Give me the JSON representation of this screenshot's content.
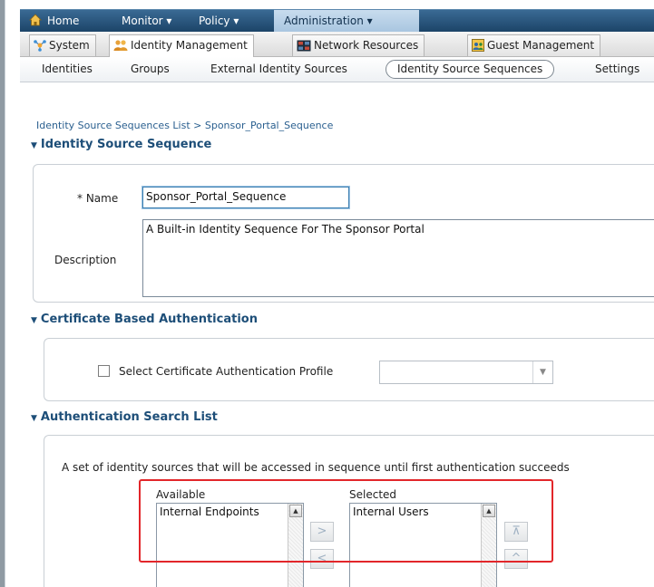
{
  "topnav": {
    "home": "Home",
    "monitor": "Monitor ▾",
    "policy": "Policy ▾",
    "administration": "Administration ▾"
  },
  "subtabs": {
    "system": "System",
    "identity_management": "Identity Management",
    "network_resources": "Network Resources",
    "guest_management": "Guest Management"
  },
  "thirdnav": {
    "identities": "Identities",
    "groups": "Groups",
    "external": "External Identity Sources",
    "sequences": "Identity Source Sequences",
    "settings": "Settings"
  },
  "breadcrumb": "Identity Source Sequences List > Sponsor_Portal_Sequence",
  "sections": {
    "identity": "Identity Source Sequence",
    "cert": "Certificate Based Authentication",
    "search": "Authentication Search List"
  },
  "form": {
    "name_label": "* Name",
    "name_value": "Sponsor_Portal_Sequence",
    "description_label": "Description",
    "description_value": "A Built-in Identity Sequence For The Sponsor Portal",
    "cert_checkbox_label": "Select Certificate Authentication Profile",
    "cert_profile_value": "",
    "search_help": "A set of identity sources that will be accessed in sequence until first authentication succeeds"
  },
  "lists": {
    "available_label": "Available",
    "available_items": [
      "Internal Endpoints"
    ],
    "selected_label": "Selected",
    "selected_items": [
      "Internal Users"
    ],
    "move_right": ">",
    "move_left": "<",
    "move_top": "⊼",
    "move_up": "^"
  },
  "colors": {
    "nav_bg": "#1c4468",
    "active_tab": "#a9c6e0",
    "section_title": "#1d4e78",
    "highlight": "#e2262a"
  }
}
